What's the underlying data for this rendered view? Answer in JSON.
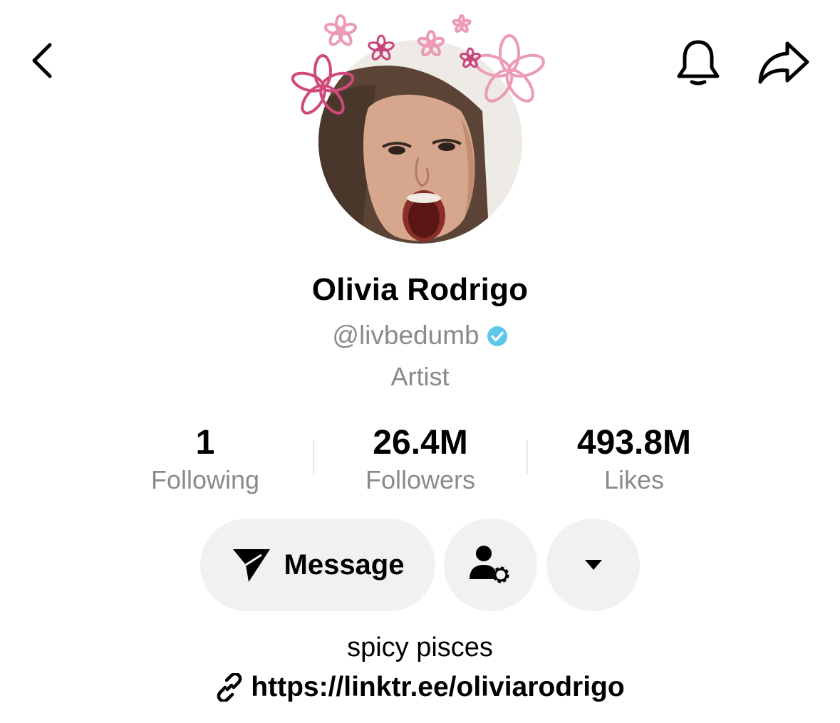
{
  "header": {
    "back_icon": "chevron-left-icon",
    "notification_icon": "bell-icon",
    "share_icon": "share-arrow-icon"
  },
  "profile": {
    "display_name": "Olivia Rodrigo",
    "username": "@livbedumb",
    "verified": true,
    "verified_color": "#5ac8ea",
    "category": "Artist",
    "avatar_decoration": "pink flowers"
  },
  "stats": {
    "following": {
      "value": "1",
      "label": "Following"
    },
    "followers": {
      "value": "26.4M",
      "label": "Followers"
    },
    "likes": {
      "value": "493.8M",
      "label": "Likes"
    }
  },
  "actions": {
    "message_label": "Message",
    "message_icon": "paper-plane-icon",
    "contacts_icon": "person-gear-icon",
    "more_icon": "caret-down-icon"
  },
  "bio": {
    "text": "spicy pisces",
    "link": "https://linktr.ee/oliviarodrigo",
    "link_icon": "link-icon"
  }
}
